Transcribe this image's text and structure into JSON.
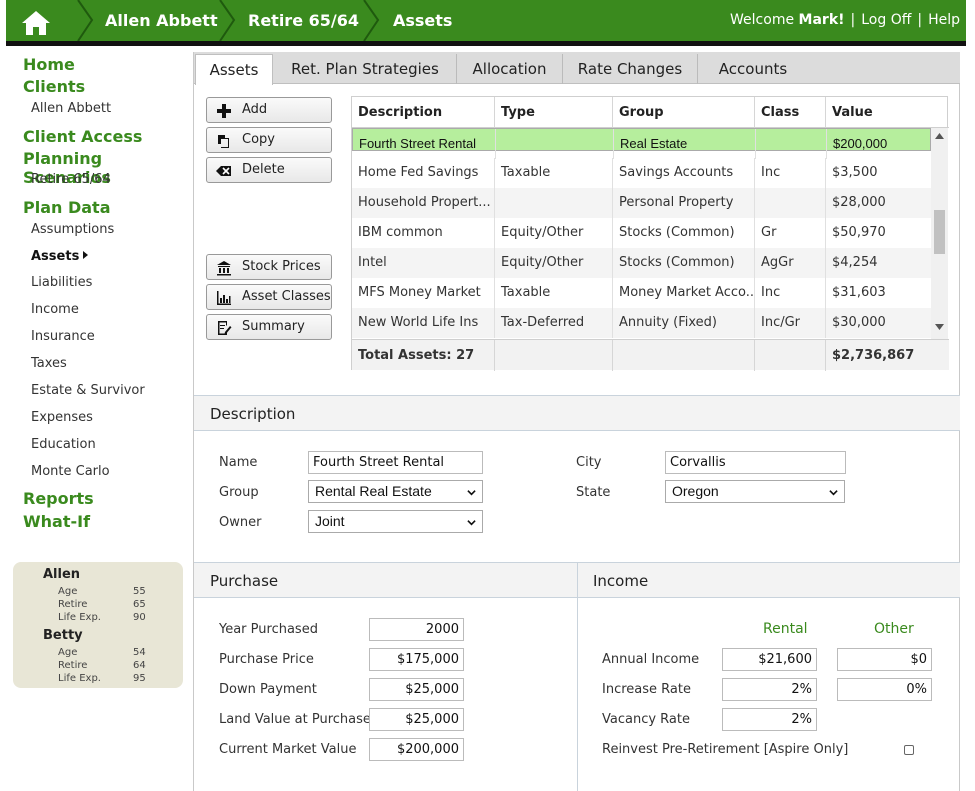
{
  "breadcrumbs": [
    "Allen Abbett",
    "Retire 65/64",
    "Assets"
  ],
  "header": {
    "welcome_prefix": "Welcome",
    "user": "Mark!",
    "logoff": "Log Off",
    "help": "Help"
  },
  "sidebar": {
    "home": "Home",
    "clients": "Clients",
    "client_name": "Allen Abbett",
    "client_access": "Client Access",
    "planning_scenarios": "Planning Scenarios",
    "scenario": "Retire 65/64",
    "plan_data": "Plan Data",
    "items": [
      "Assumptions",
      "Assets",
      "Liabilities",
      "Income",
      "Insurance",
      "Taxes",
      "Estate & Survivor",
      "Expenses",
      "Education",
      "Monte Carlo"
    ],
    "reports": "Reports",
    "what_if": "What-If"
  },
  "people": [
    {
      "name": "Allen",
      "age_label": "Age",
      "age": "55",
      "retire_label": "Retire",
      "retire": "65",
      "life_label": "Life Exp.",
      "life": "90"
    },
    {
      "name": "Betty",
      "age_label": "Age",
      "age": "54",
      "retire_label": "Retire",
      "retire": "64",
      "life_label": "Life Exp.",
      "life": "95"
    }
  ],
  "tabs": [
    "Assets",
    "Ret. Plan Strategies",
    "Allocation",
    "Rate Changes",
    "Accounts"
  ],
  "buttons": {
    "add": "Add",
    "copy": "Copy",
    "delete": "Delete",
    "stock_prices": "Stock Prices",
    "asset_classes": "Asset Classes",
    "summary": "Summary"
  },
  "grid": {
    "headers": [
      "Description",
      "Type",
      "Group",
      "Class",
      "Value"
    ],
    "rows": [
      [
        "Fourth Street Rental",
        "",
        "Real Estate",
        "",
        "$200,000"
      ],
      [
        "Home Fed Savings",
        "Taxable",
        "Savings Accounts",
        "Inc",
        "$3,500"
      ],
      [
        "Household Propert...",
        "",
        "Personal Property",
        "",
        "$28,000"
      ],
      [
        "IBM common",
        "Equity/Other",
        "Stocks (Common)",
        "Gr",
        "$50,970"
      ],
      [
        "Intel",
        "Equity/Other",
        "Stocks (Common)",
        "AgGr",
        "$4,254"
      ],
      [
        "MFS Money Market",
        "Taxable",
        "Money Market Acco...",
        "Inc",
        "$31,603"
      ],
      [
        "New World Life Ins",
        "Tax-Deferred",
        "Annuity (Fixed)",
        "Inc/Gr",
        "$30,000"
      ]
    ],
    "total_label": "Total Assets: 27",
    "total_value": "$2,736,867"
  },
  "description": {
    "title": "Description",
    "name_label": "Name",
    "name_value": "Fourth Street Rental",
    "group_label": "Group",
    "group_value": "Rental Real Estate",
    "owner_label": "Owner",
    "owner_value": "Joint",
    "city_label": "City",
    "city_value": "Corvallis",
    "state_label": "State",
    "state_value": "Oregon"
  },
  "purchase": {
    "title": "Purchase",
    "year_label": "Year Purchased",
    "year": "2000",
    "price_label": "Purchase Price",
    "price": "$175,000",
    "down_label": "Down Payment",
    "down": "$25,000",
    "land_label": "Land Value at Purchase",
    "land": "$25,000",
    "market_label": "Current Market Value",
    "market": "$200,000"
  },
  "income": {
    "title": "Income",
    "col_rental": "Rental",
    "col_other": "Other",
    "annual_label": "Annual Income",
    "annual_rental": "$21,600",
    "annual_other": "$0",
    "increase_label": "Increase Rate",
    "increase_rental": "2%",
    "increase_other": "0%",
    "vacancy_label": "Vacancy Rate",
    "vacancy_rental": "2%",
    "reinvest_label": "Reinvest Pre-Retirement [Aspire Only]"
  },
  "colors": {
    "brand_green": "#3a8a1e",
    "selected_row": "#b6ee9d"
  }
}
